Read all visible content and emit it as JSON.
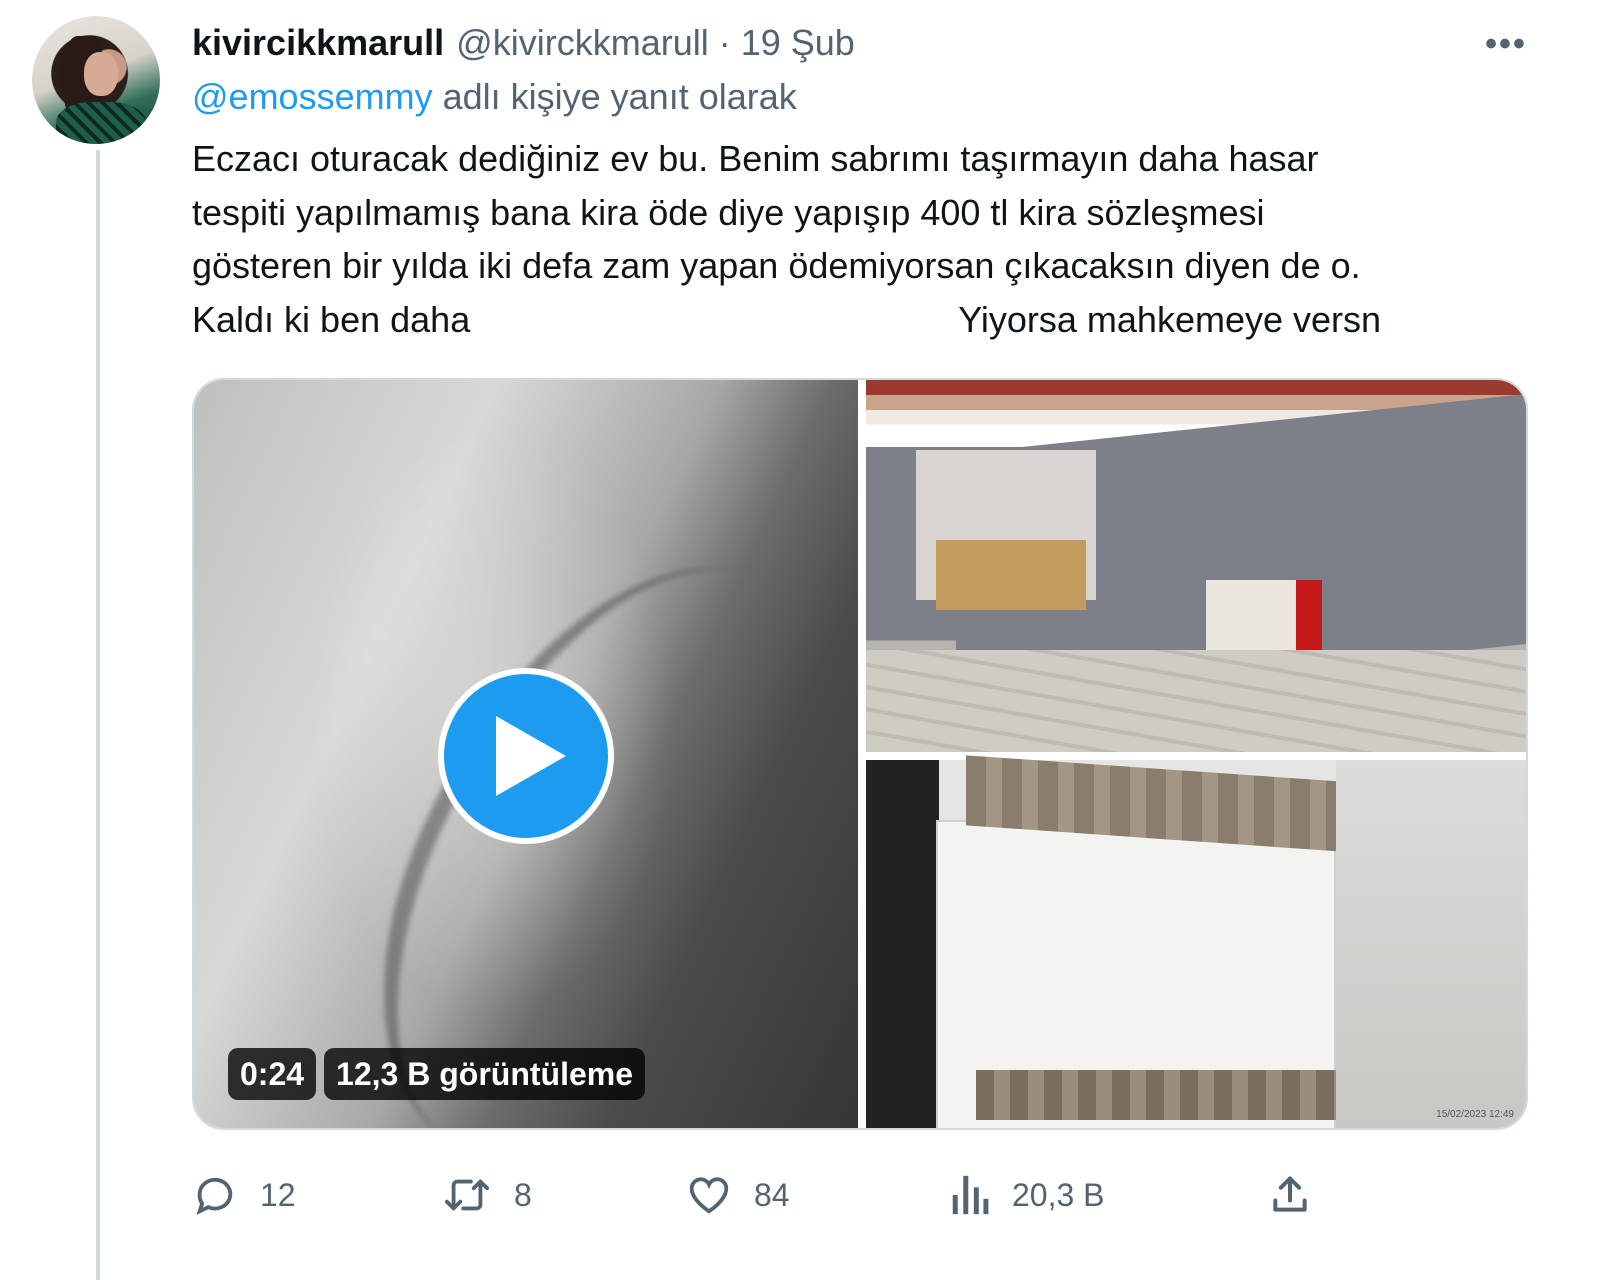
{
  "author": {
    "display_name": "kivircikkmarull",
    "handle": "@kivirckkmarull",
    "separator": "·",
    "date": "19 Şub"
  },
  "reply": {
    "mention": "@emossemmy",
    "suffix": "adlı kişiye yanıt olarak"
  },
  "tweet": {
    "lines": [
      "Eczacı oturacak dediğiniz ev bu. Benim sabrımı taşırmayın daha hasar",
      "tespiti yapılmamış bana kira öde diye yapışıp 400 tl kira sözleşmesi",
      "gösteren bir yılda iki defa zam yapan ödemiyorsan çıkacaksın diyen de o."
    ],
    "last_line_left": "Kaldı ki ben daha",
    "last_line_right": "Yiyorsa mahkemeye versn"
  },
  "media": {
    "video_duration": "0:24",
    "video_views": "12,3 B görüntüleme",
    "photo_timestamp": "15/02/2023 12:49"
  },
  "actions": {
    "replies": "12",
    "retweets": "8",
    "likes": "84",
    "views": "20,3 B"
  },
  "icons": {
    "more": "more-dots-icon",
    "reply": "reply-bubble-icon",
    "retweet": "retweet-icon",
    "like": "heart-icon",
    "views": "views-bar-chart-icon",
    "share": "share-upload-icon",
    "play": "play-icon"
  },
  "colors": {
    "accent": "#1d9bf0",
    "secondary_text": "#536471",
    "primary_text": "#0f1419"
  }
}
